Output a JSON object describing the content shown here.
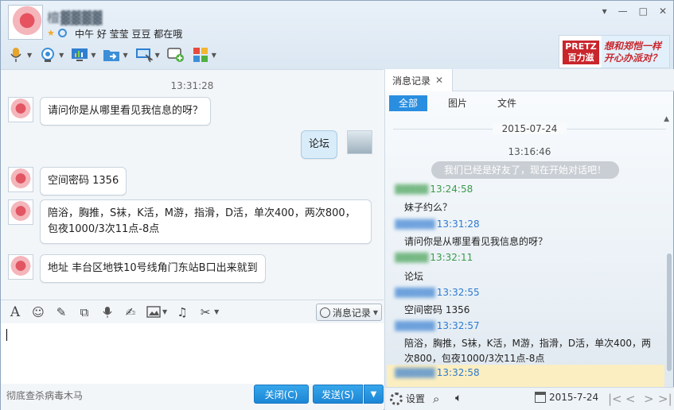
{
  "header": {
    "contact_name": "檀▓▓▓▓",
    "signature": "中午 好 莹莹 豆豆 都在哦",
    "window_controls": [
      "▾",
      "—",
      "□",
      "✕"
    ],
    "ad": {
      "brand": "PRETZ 百力滋",
      "slogan": "想和郑恺一样 开心办派对？"
    }
  },
  "chat": {
    "timestamp": "13:31:28",
    "messages": [
      {
        "from": "them",
        "text": "请问你是从哪里看见我信息的呀？"
      },
      {
        "from": "me",
        "text": "论坛"
      },
      {
        "from": "them",
        "text": "空间密码 1356"
      },
      {
        "from": "them",
        "text": "陪浴，胸推，S袜，K活，M游，指滑，D活，单次400，两次800，包夜1000/3次11点-8点"
      },
      {
        "from": "them",
        "text": "地址 丰台区地铁10号线角门东站B口出来就到"
      }
    ]
  },
  "input": {
    "history_button": "消息记录",
    "virus_text": "彻底查杀病毒木马",
    "close_button": "关闭(C)",
    "send_button": "发送(S)"
  },
  "history": {
    "tab_label": "消息记录",
    "filters": [
      "全部",
      "图片",
      "文件"
    ],
    "date": "2015-07-24",
    "first_time": "13:16:46",
    "system_message": "我们已经是好友了，现在开始对话吧！",
    "entries": [
      {
        "time": "13:24:58",
        "color": "green",
        "text": "妹子约么？"
      },
      {
        "time": "13:31:28",
        "color": "blue",
        "text": "请问你是从哪里看见我信息的呀？"
      },
      {
        "time": "13:32:11",
        "color": "green",
        "text": "论坛"
      },
      {
        "time": "13:32:55",
        "color": "blue",
        "text": "空间密码 1356"
      },
      {
        "time": "13:32:57",
        "color": "blue",
        "text": "陪浴，胸推，S袜，K活，M游，指滑，D活，单次400，两次800，包夜1000/3次11点-8点"
      },
      {
        "time": "13:32:58",
        "color": "blue",
        "text": ""
      }
    ],
    "footer": {
      "settings": "设置",
      "date": "2015-7-24"
    }
  }
}
